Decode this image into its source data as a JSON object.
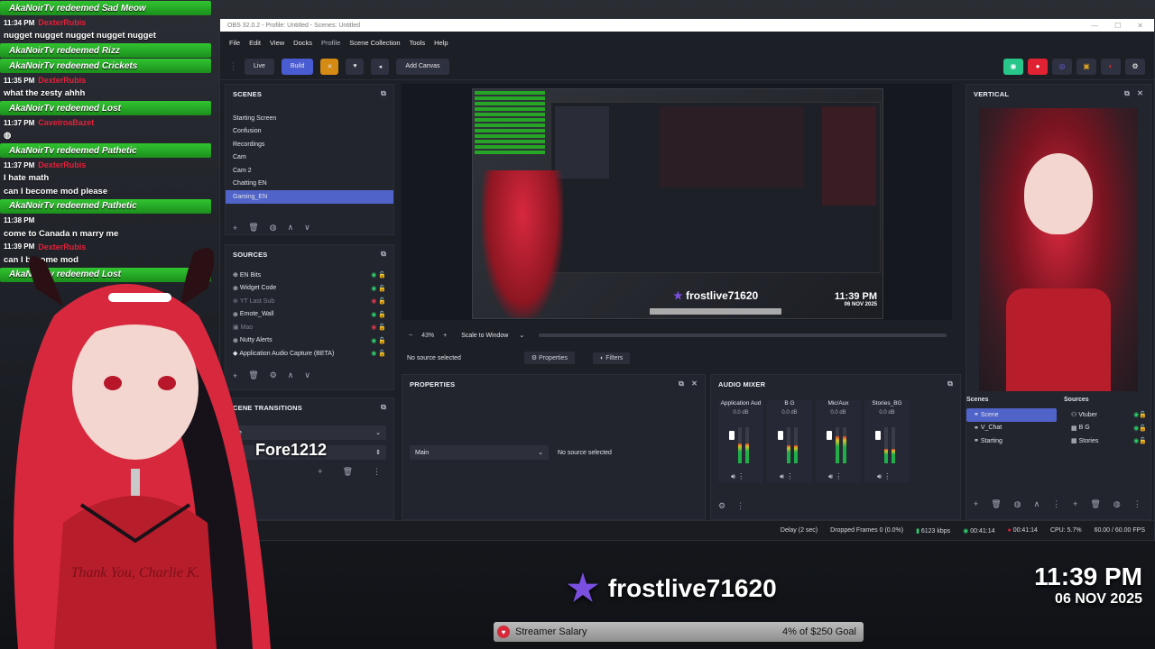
{
  "chat": {
    "lines": [
      {
        "kind": "redeem",
        "text": "AkaNoirTv redeemed Sad Meow"
      },
      {
        "kind": "msg",
        "time": "11:34 PM",
        "user": "DexterRubis",
        "text": ""
      },
      {
        "kind": "plain",
        "text": "nugget nugget nugget nugget nugget"
      },
      {
        "kind": "redeem",
        "text": "AkaNoirTv redeemed Rizz"
      },
      {
        "kind": "redeem",
        "text": "AkaNoirTv redeemed Crickets"
      },
      {
        "kind": "msg",
        "time": "11:35 PM",
        "user": "DexterRubis",
        "text": ""
      },
      {
        "kind": "plain",
        "text": "what the zesty ahhh"
      },
      {
        "kind": "redeem",
        "text": "AkaNoirTv redeemed Lost"
      },
      {
        "kind": "msg",
        "time": "11:37 PM",
        "user": "CaveiroaBazet",
        "text": ""
      },
      {
        "kind": "plain",
        "text": ""
      },
      {
        "kind": "redeem",
        "text": "AkaNoirTv redeemed Pathetic"
      },
      {
        "kind": "msg",
        "time": "11:37 PM",
        "user": "DexterRubis",
        "text": ""
      },
      {
        "kind": "plain",
        "text": "I hate math"
      },
      {
        "kind": "plain",
        "text": "can I become mod please"
      },
      {
        "kind": "redeem",
        "text": "AkaNoirTv redeemed Pathetic"
      },
      {
        "kind": "msg",
        "time": "11:38 PM",
        "user": "",
        "text": ""
      },
      {
        "kind": "plain",
        "text": "come to Canada n marry me"
      },
      {
        "kind": "msg",
        "time": "11:39 PM",
        "user": "DexterRubis",
        "text": ""
      },
      {
        "kind": "plain",
        "text": "can I become mod"
      },
      {
        "kind": "redeem",
        "text": "AkaNoirTv redeemed Lost"
      }
    ]
  },
  "obs": {
    "title": "OBS 32.0.2 - Profile: Untitled - Scenes: Untitled",
    "menu": [
      "File",
      "Edit",
      "View",
      "Docks",
      "Profile",
      "Scene Collection",
      "Tools",
      "Help"
    ],
    "toolbar": {
      "live": "Live",
      "build": "Build",
      "add_canvas": "Add Canvas"
    },
    "scenes": {
      "title": "SCENES",
      "items": [
        "Starting Screen",
        "Confusion",
        "Recordings",
        "Cam",
        "Cam 2",
        "Chatting EN",
        "Gaming_EN"
      ],
      "selected_index": 6
    },
    "sources": {
      "title": "SOURCES",
      "items": [
        "EN Bits",
        "Widget Code",
        "YT Last Sub",
        "Emote_Wall",
        "Mao",
        "Nutty Alerts",
        "Application Audio Capture (BETA)"
      ]
    },
    "transitions": {
      "title": "CENE TRANSITIONS",
      "value": "e"
    },
    "preview": {
      "zoom": "43%",
      "scale_mode": "Scale to Window",
      "mini_name": "frostlive71620",
      "mini_time": "11:39 PM",
      "mini_date": "06 NOV 2025"
    },
    "source_bar": {
      "status": "No source selected",
      "properties": "Properties",
      "filters": "Filters"
    },
    "properties": {
      "title": "PROPERTIES",
      "select": "Main",
      "status": "No source selected"
    },
    "mixer": {
      "title": "AUDIO MIXER",
      "channels": [
        {
          "name": "Application Aud",
          "db": "0.0 dB",
          "level": 0.55
        },
        {
          "name": "B G",
          "db": "0.0 dB",
          "level": 0.5
        },
        {
          "name": "Mic/Aux",
          "db": "0.0 dB",
          "level": 0.75
        },
        {
          "name": "Stories_BG",
          "db": "0.0 dB",
          "level": 0.4
        }
      ]
    },
    "vertical": {
      "title": "VERTICAL",
      "scenes_label": "Scenes",
      "sources_label": "Sources",
      "scenes": [
        "Scene",
        "V_Chat",
        "Starting"
      ],
      "sources": [
        "Vtuber",
        "B G",
        "Stories"
      ]
    },
    "status": {
      "delay": "Delay (2 sec)",
      "dropped": "Dropped Frames 0 (0.0%)",
      "bitrate": "6123 kbps",
      "stream_time": "00:41:14",
      "rec_time": "00:41:14",
      "cpu": "CPU: 5.7%",
      "fps": "60.00 / 60.00 FPS"
    }
  },
  "overlay": {
    "channel": "frostlive71620",
    "time": "11:39 PM",
    "date": "06 NOV 2025",
    "goal_label": "Streamer Salary",
    "goal_progress": "4% of $250 Goal",
    "floating_name": "Fore1212",
    "shirt_text": "Thank You, Charlie K."
  },
  "colors": {
    "accent": "#4f63c9",
    "chat_green": "#31c431",
    "chat_user": "#e3213a",
    "hair": "#d8283e"
  }
}
